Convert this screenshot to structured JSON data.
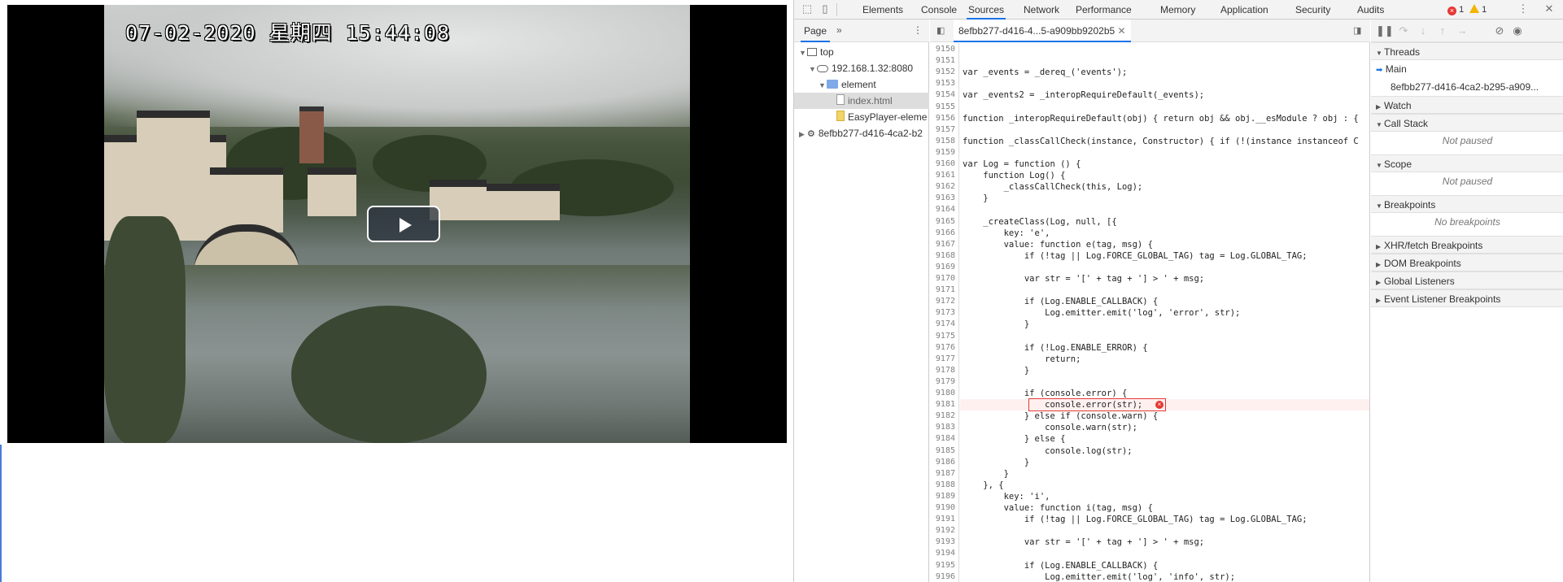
{
  "page": {
    "video": {
      "timestamp": "07-02-2020 星期四 15:44:08",
      "play_button": "play"
    }
  },
  "devtools": {
    "tabs": [
      "Elements",
      "Console",
      "Sources",
      "Network",
      "Performance",
      "Memory",
      "Application",
      "Security",
      "Audits"
    ],
    "active_tab": "Sources",
    "error_count": "1",
    "warning_count": "1",
    "navigator": {
      "tab_label": "Page",
      "items": [
        {
          "label": "top",
          "indent": 0
        },
        {
          "label": "192.168.1.32:8080",
          "indent": 1
        },
        {
          "label": "element",
          "indent": 2
        },
        {
          "label": "index.html",
          "indent": 3
        },
        {
          "label": "EasyPlayer-eleme",
          "indent": 3
        },
        {
          "label": "8efbb277-d416-4ca2-b2",
          "indent": 0
        }
      ]
    },
    "editor": {
      "file_tab": "8efbb277-d416-4...5-a909bb9202b5",
      "lines": [
        {
          "n": "9150",
          "code": ""
        },
        {
          "n": "9151",
          "code": ""
        },
        {
          "n": "9152",
          "code": "var _events = _dereq_('events');"
        },
        {
          "n": "9153",
          "code": ""
        },
        {
          "n": "9154",
          "code": "var _events2 = _interopRequireDefault(_events);"
        },
        {
          "n": "9155",
          "code": ""
        },
        {
          "n": "9156",
          "code": "function _interopRequireDefault(obj) { return obj && obj.__esModule ? obj : {"
        },
        {
          "n": "9157",
          "code": ""
        },
        {
          "n": "9158",
          "code": "function _classCallCheck(instance, Constructor) { if (!(instance instanceof C"
        },
        {
          "n": "9159",
          "code": ""
        },
        {
          "n": "9160",
          "code": "var Log = function () {"
        },
        {
          "n": "9161",
          "code": "    function Log() {"
        },
        {
          "n": "9162",
          "code": "        _classCallCheck(this, Log);"
        },
        {
          "n": "9163",
          "code": "    }"
        },
        {
          "n": "9164",
          "code": ""
        },
        {
          "n": "9165",
          "code": "    _createClass(Log, null, [{"
        },
        {
          "n": "9166",
          "code": "        key: 'e',"
        },
        {
          "n": "9167",
          "code": "        value: function e(tag, msg) {"
        },
        {
          "n": "9168",
          "code": "            if (!tag || Log.FORCE_GLOBAL_TAG) tag = Log.GLOBAL_TAG;"
        },
        {
          "n": "9169",
          "code": ""
        },
        {
          "n": "9170",
          "code": "            var str = '[' + tag + '] > ' + msg;"
        },
        {
          "n": "9171",
          "code": ""
        },
        {
          "n": "9172",
          "code": "            if (Log.ENABLE_CALLBACK) {"
        },
        {
          "n": "9173",
          "code": "                Log.emitter.emit('log', 'error', str);"
        },
        {
          "n": "9174",
          "code": "            }"
        },
        {
          "n": "9175",
          "code": ""
        },
        {
          "n": "9176",
          "code": "            if (!Log.ENABLE_ERROR) {"
        },
        {
          "n": "9177",
          "code": "                return;"
        },
        {
          "n": "9178",
          "code": "            }"
        },
        {
          "n": "9179",
          "code": ""
        },
        {
          "n": "9180",
          "code": "            if (console.error) {"
        },
        {
          "n": "9181",
          "code": "                console.error(str);"
        },
        {
          "n": "9182",
          "code": "            } else if (console.warn) {"
        },
        {
          "n": "9183",
          "code": "                console.warn(str);"
        },
        {
          "n": "9184",
          "code": "            } else {"
        },
        {
          "n": "9185",
          "code": "                console.log(str);"
        },
        {
          "n": "9186",
          "code": "            }"
        },
        {
          "n": "9187",
          "code": "        }"
        },
        {
          "n": "9188",
          "code": "    }, {"
        },
        {
          "n": "9189",
          "code": "        key: 'i',"
        },
        {
          "n": "9190",
          "code": "        value: function i(tag, msg) {"
        },
        {
          "n": "9191",
          "code": "            if (!tag || Log.FORCE_GLOBAL_TAG) tag = Log.GLOBAL_TAG;"
        },
        {
          "n": "9192",
          "code": ""
        },
        {
          "n": "9193",
          "code": "            var str = '[' + tag + '] > ' + msg;"
        },
        {
          "n": "9194",
          "code": ""
        },
        {
          "n": "9195",
          "code": "            if (Log.ENABLE_CALLBACK) {"
        },
        {
          "n": "9196",
          "code": "                Log.emitter.emit('log', 'info', str);"
        }
      ],
      "error_line": "9181"
    },
    "debugger": {
      "threads_label": "Threads",
      "thread_main": "Main",
      "thread_worker": "8efbb277-d416-4ca2-b295-a909...",
      "watch_label": "Watch",
      "callstack_label": "Call Stack",
      "callstack_status": "Not paused",
      "scope_label": "Scope",
      "scope_status": "Not paused",
      "breakpoints_label": "Breakpoints",
      "breakpoints_status": "No breakpoints",
      "xhr_label": "XHR/fetch Breakpoints",
      "dom_label": "DOM Breakpoints",
      "global_label": "Global Listeners",
      "event_label": "Event Listener Breakpoints"
    }
  }
}
